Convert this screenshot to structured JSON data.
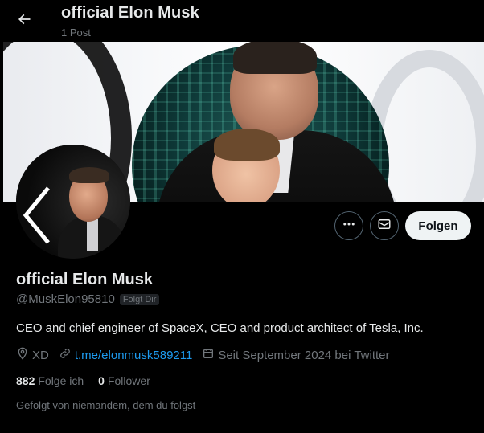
{
  "header": {
    "title": "official Elon Musk",
    "post_count": "1 Post"
  },
  "icons": {
    "back": "back-arrow-icon",
    "more": "more-dots-icon",
    "message": "envelope-icon",
    "location": "location-pin-icon",
    "link": "link-icon",
    "calendar": "calendar-icon"
  },
  "profile": {
    "name": "official Elon Musk",
    "handle": "@MuskElon95810",
    "follows_you_badge": "Folgt Dir",
    "bio": "CEO and chief engineer of SpaceX, CEO and product architect of Tesla, Inc.",
    "location": "XD",
    "link": "t.me/elonmusk589211",
    "joined": "Seit September 2024 bei Twitter",
    "following_count": "882",
    "following_label": "Folge ich",
    "followers_count": "0",
    "followers_label": "Follower",
    "followed_by": "Gefolgt von niemandem, dem du folgst"
  },
  "actions": {
    "follow_label": "Folgen"
  },
  "colors": {
    "background": "#000000",
    "text": "#e7e9ea",
    "secondary": "#71767b",
    "link": "#1d9bf0",
    "follow_button_bg": "#eff3f4"
  }
}
